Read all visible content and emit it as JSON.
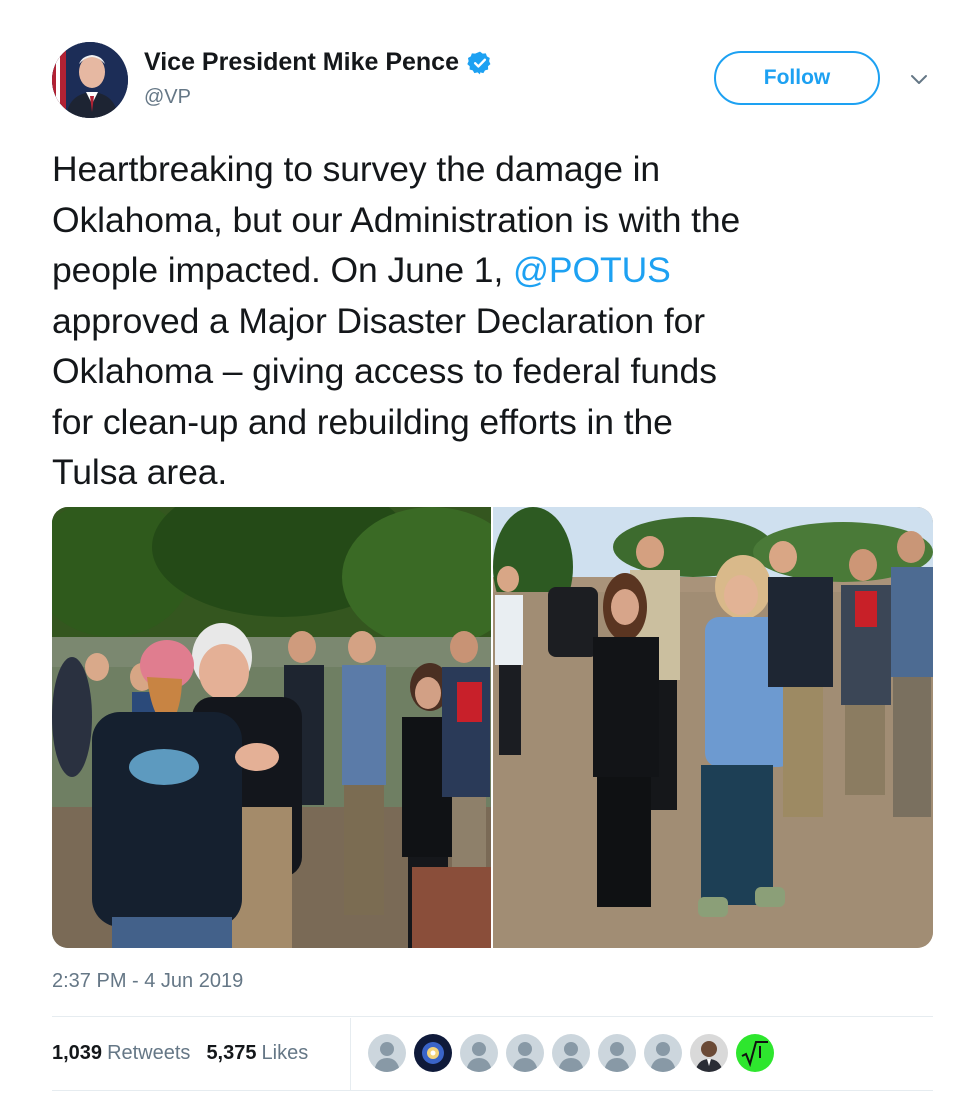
{
  "tweet": {
    "author": {
      "display_name": "Vice President Mike Pence",
      "handle": "@VP",
      "verified": true,
      "avatar_icon": "profile-photo"
    },
    "follow_label": "Follow",
    "menu_icon": "chevron-down-icon",
    "text_before": "Heartbreaking to survey the damage in\nOklahoma, but our Administration is with the\npeople impacted. On June 1, ",
    "mention": "@POTUS",
    "text_after": "\napproved a Major Disaster Declaration for\nOklahoma – giving access to federal funds\nfor clean-up and rebuilding efforts in the\nTulsa area.",
    "photos": [
      {
        "icon": "photo-embrace"
      },
      {
        "icon": "photo-walking-group"
      }
    ],
    "timestamp": "2:37 PM - 4 Jun 2019",
    "stats": {
      "retweets_count": "1,039",
      "retweets_label": "Retweets",
      "likes_count": "5,375",
      "likes_label": "Likes"
    },
    "likers": [
      {
        "icon": "default-avatar-icon"
      },
      {
        "icon": "galaxy-avatar-icon"
      },
      {
        "icon": "default-avatar-icon"
      },
      {
        "icon": "default-avatar-icon"
      },
      {
        "icon": "default-avatar-icon"
      },
      {
        "icon": "default-avatar-icon"
      },
      {
        "icon": "default-avatar-icon"
      },
      {
        "icon": "person-avatar-icon"
      },
      {
        "icon": "sqrt-avatar-icon"
      }
    ]
  },
  "colors": {
    "link": "#1da1f2",
    "text": "#14171a",
    "secondary": "#657786",
    "divider": "#e6ecf0"
  }
}
